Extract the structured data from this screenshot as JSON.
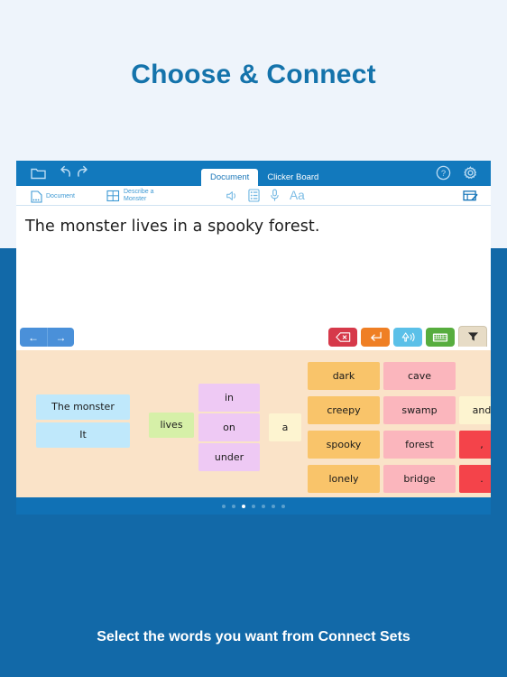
{
  "headline": "Choose & Connect",
  "caption": "Select the words you want from Connect Sets",
  "colors": {
    "page_top_bg": "#eef4fb",
    "page_bottom_bg": "#1269a8",
    "headline": "#1473ab",
    "toolbar": "#1279bd",
    "grid_bg": "#fae3c8"
  },
  "toolbar": {
    "folder_icon": "folder-icon",
    "undo_icon": "undo-icon",
    "redo_icon": "redo-icon",
    "help_icon": "help-icon",
    "gear_icon": "gear-icon",
    "tabs": [
      {
        "label": "Document",
        "active": true
      },
      {
        "label": "Clicker Board",
        "active": false
      }
    ]
  },
  "subbar": {
    "document_label": "Document",
    "set_label_line1": "Describe a",
    "set_label_line2": "Monster",
    "icons": [
      "speaker-icon",
      "list-icon",
      "microphone-icon",
      "font-size-icon"
    ],
    "right_icon": "document-edit-icon"
  },
  "document": {
    "text": "The monster lives in a spooky forest."
  },
  "nav": {
    "back_arrow": "←",
    "forward_arrow": "→"
  },
  "keys": [
    {
      "name": "backspace-key",
      "color": "red",
      "icon": "backspace-icon"
    },
    {
      "name": "return-key",
      "color": "orange",
      "icon": "return-icon"
    },
    {
      "name": "speak-key",
      "color": "blue",
      "icon": "speak-icon"
    },
    {
      "name": "keyboard-key",
      "color": "green",
      "icon": "keyboard-icon"
    },
    {
      "name": "filter-tab",
      "color": "tan",
      "icon": "funnel-icon"
    }
  ],
  "word_grid": {
    "columns": [
      {
        "name": "subject",
        "color": "c-blue",
        "words": [
          "The monster",
          "It"
        ]
      },
      {
        "name": "verb",
        "color": "c-green",
        "words": [
          "lives"
        ]
      },
      {
        "name": "preposition",
        "color": "c-purple",
        "words": [
          "in",
          "on",
          "under"
        ]
      },
      {
        "name": "article",
        "color": "c-cream",
        "words": [
          "a"
        ]
      },
      {
        "name": "adjective",
        "color": "c-orange",
        "words": [
          "dark",
          "creepy",
          "spooky",
          "lonely"
        ]
      },
      {
        "name": "noun",
        "color": "c-pink",
        "words": [
          "cave",
          "swamp",
          "forest",
          "bridge"
        ]
      },
      {
        "name": "connective-punctuation",
        "words": [
          {
            "text": "and",
            "color": "c-cream"
          },
          {
            "text": ",",
            "color": "c-red"
          },
          {
            "text": ".",
            "color": "c-red"
          }
        ]
      }
    ]
  },
  "pager": {
    "count": 7,
    "active_index": 2
  }
}
